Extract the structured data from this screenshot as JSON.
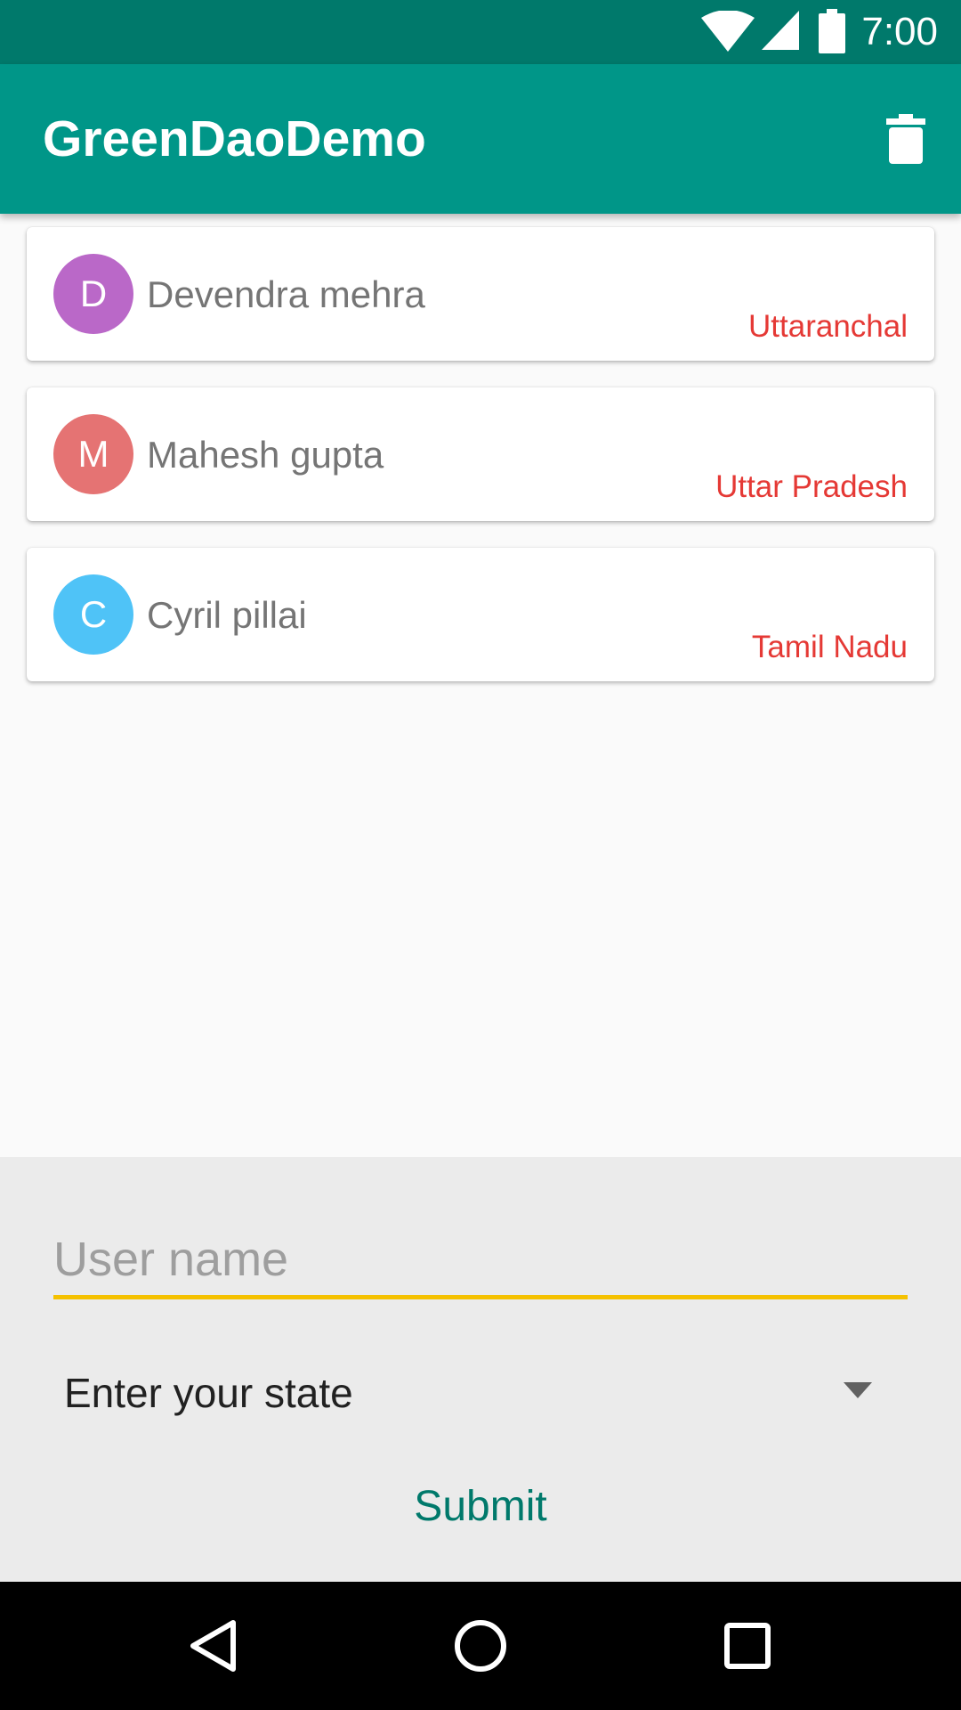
{
  "status_bar": {
    "time": "7:00",
    "icons": [
      "wifi-icon",
      "signal-icon",
      "battery-icon"
    ]
  },
  "app_bar": {
    "title": "GreenDaoDemo",
    "action_icon": "trash-icon",
    "color": "#009688"
  },
  "users": [
    {
      "initial": "D",
      "name": "Devendra mehra",
      "state": "Uttaranchal",
      "avatar_color": "#ba68c8"
    },
    {
      "initial": "M",
      "name": "Mahesh gupta",
      "state": "Uttar Pradesh",
      "avatar_color": "#e57373"
    },
    {
      "initial": "C",
      "name": "Cyril pillai",
      "state": "Tamil Nadu",
      "avatar_color": "#4fc3f7"
    }
  ],
  "form": {
    "username_placeholder": "User name",
    "username_value": "",
    "state_selected": "Enter your state",
    "submit_label": "Submit",
    "accent_color": "#f5c100"
  },
  "nav_bar": {
    "icons": [
      "back-icon",
      "home-icon",
      "recents-icon"
    ]
  }
}
